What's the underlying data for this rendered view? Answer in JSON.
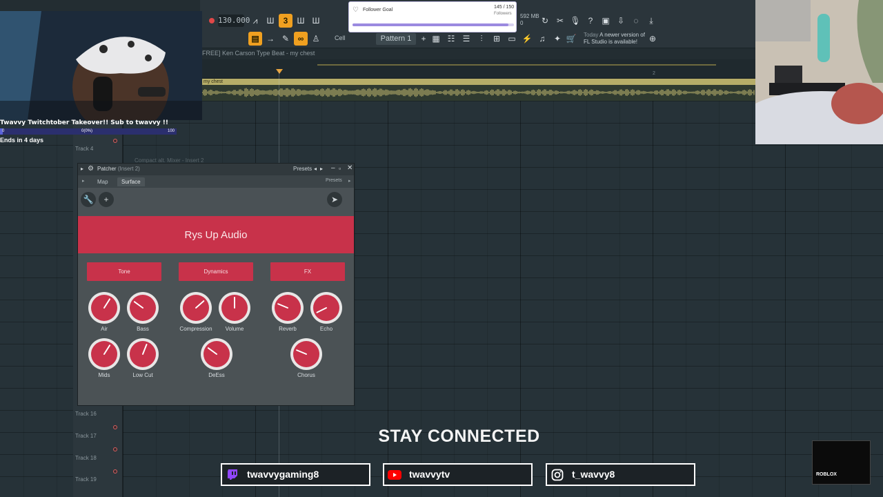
{
  "toolbar": {
    "tempo": "130.000",
    "pattern_label": "Pattern 1",
    "snap_label": "Cell",
    "memory": "592 MB",
    "memory_sub": "0",
    "news_date": "Today",
    "news_text": "A newer version of FL Studio is available!"
  },
  "playlist": {
    "title": "FREE] Ken Carson Type Beat - my chest",
    "clip_name": "my chest",
    "bar_number": "2",
    "mixer_ghost": "Compact alt. Mixer - Insert 2",
    "tracks": [
      {
        "label": "Track 4"
      },
      {
        "label": "Track 16"
      },
      {
        "label": "Track 17"
      },
      {
        "label": "Track 18"
      },
      {
        "label": "Track 19"
      }
    ]
  },
  "patcher": {
    "title": "Patcher",
    "subtitle": "(Insert 2)",
    "presets_label": "Presets",
    "tab_map": "Map",
    "tab_surface": "Surface",
    "surface_presets": "Presets",
    "brand": "Rys Up Audio",
    "sections": [
      "Tone",
      "Dynamics",
      "FX"
    ],
    "knobs": [
      {
        "label": "Air",
        "value": 0.62
      },
      {
        "label": "Bass",
        "value": 0.3
      },
      {
        "label": "Compression",
        "value": 0.68
      },
      {
        "label": "Volume",
        "value": 0.5
      },
      {
        "label": "Reverb",
        "value": 0.25
      },
      {
        "label": "Echo",
        "value": 0.07
      },
      {
        "label": "Mids",
        "value": 0.62
      },
      {
        "label": "Low Cut",
        "value": 0.58
      },
      {
        "label": "DeEss",
        "value": 0.3
      },
      {
        "label": "Chorus",
        "value": 0.25
      }
    ]
  },
  "stream": {
    "takeover_text": "Twavvy Twitchtober Takeover!! Sub to twavvy !!",
    "goal_min": "0",
    "goal_pct": "0(0%)",
    "goal_max": "100",
    "ends_text": "Ends in 4 days",
    "follower_goal_title": "Follower Goal",
    "follower_goal_count": "145 / 150",
    "follower_goal_sub": "Followers",
    "follower_progress": 0.967,
    "stay_connected": "STAY CONNECTED",
    "socials": [
      {
        "platform": "twitch",
        "handle": "twavvygaming8",
        "color": "#9146ff"
      },
      {
        "platform": "youtube",
        "handle": "twavvytv",
        "color": "#ff0000"
      },
      {
        "platform": "instagram",
        "handle": "t_wavvy8",
        "color": "#ffffff"
      }
    ],
    "promo_brand": "ROBLOX"
  },
  "colors": {
    "brand_red": "#c8324a",
    "fl_orange": "#f0a020",
    "clip_gold": "#b6ad68"
  }
}
